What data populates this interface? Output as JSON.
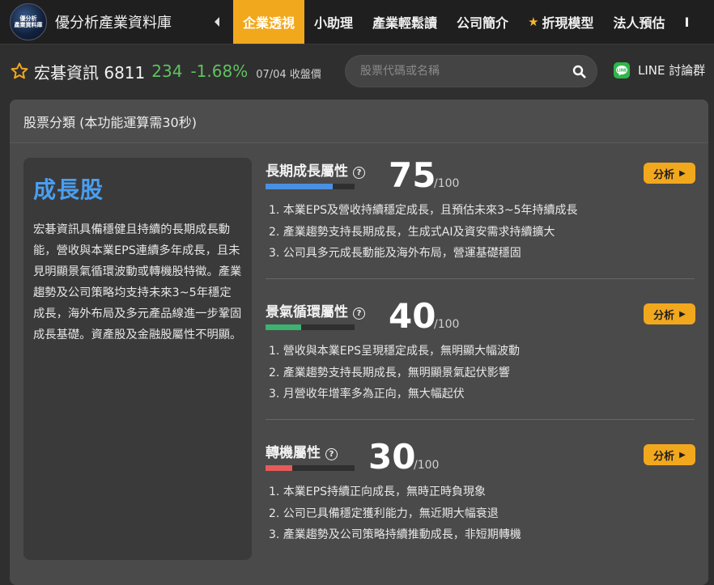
{
  "nav": {
    "logo_line1": "優分析",
    "logo_line2": "產業資料庫",
    "brand": "優分析產業資料庫",
    "items": [
      {
        "label": "企業透視",
        "active": true
      },
      {
        "label": "小助理"
      },
      {
        "label": "產業輕鬆讀"
      },
      {
        "label": "公司簡介"
      },
      {
        "label": "折現模型",
        "star": true
      },
      {
        "label": "法人預估"
      },
      {
        "label": "I"
      }
    ]
  },
  "stock": {
    "name_code": "宏碁資訊 6811",
    "price": "234",
    "change": "-1.68%",
    "date_status": "07/04 收盤價"
  },
  "search": {
    "placeholder": "股票代碼或名稱"
  },
  "line": {
    "icon_text": "LINE",
    "label": "LINE 討論群"
  },
  "card": {
    "header": "股票分類 (本功能運算需30秒)",
    "summary": {
      "title": "成長股",
      "text": "宏碁資訊具備穩健且持續的長期成長動能，營收與本業EPS連續多年成長，且未見明顯景氣循環波動或轉機股特徵。產業趨勢及公司策略均支持未來3~5年穩定成長，海外布局及多元產品線進一步鞏固成長基礎。資產股及金融股屬性不明顯。"
    },
    "attributes": [
      {
        "name": "長期成長屬性",
        "score": "75",
        "max": "/100",
        "level": 0.75,
        "bar_color": "#4a90e2",
        "button": "分析",
        "reasons": [
          "1. 本業EPS及營收持續穩定成長，且預估未來3~5年持續成長",
          "2. 產業趨勢支持長期成長，生成式AI及資安需求持續擴大",
          "3. 公司具多元成長動能及海外布局，營運基礎穩固"
        ]
      },
      {
        "name": "景氣循環屬性",
        "score": "40",
        "max": "/100",
        "level": 0.4,
        "bar_color": "#3cb371",
        "button": "分析",
        "reasons": [
          "1. 營收與本業EPS呈現穩定成長，無明顯大幅波動",
          "2. 產業趨勢支持長期成長，無明顯景氣起伏影響",
          "3. 月營收年增率多為正向，無大幅起伏"
        ]
      },
      {
        "name": "轉機屬性",
        "score": "30",
        "max": "/100",
        "level": 0.3,
        "bar_color": "#e85a5a",
        "button": "分析",
        "reasons": [
          "1. 本業EPS持續正向成長，無時正時負現象",
          "2. 公司已具備穩定獲利能力，無近期大幅衰退",
          "3. 產業趨勢及公司策略持續推動成長，非短期轉機"
        ]
      }
    ]
  }
}
